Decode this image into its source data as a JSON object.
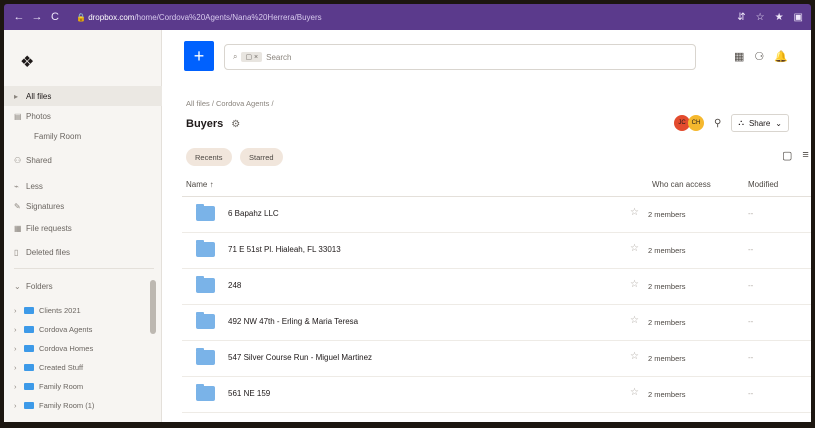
{
  "browser": {
    "nav": [
      "←",
      "→",
      "C"
    ],
    "url_host": "dropbox.com",
    "url_path": "/home/Cordova%20Agents/Nana%20Herrera/Buyers",
    "right_icons": [
      "⇵",
      "☆",
      "★",
      "▣"
    ]
  },
  "sidebar": {
    "logo": "❖",
    "items": [
      {
        "icon": "▸",
        "label": "All files"
      },
      {
        "icon": "▤",
        "label": "Photos"
      },
      {
        "icon": "",
        "label": "Family Room"
      },
      {
        "icon": "⚇",
        "label": "Shared"
      },
      {
        "icon": "⌁",
        "label": "Less"
      },
      {
        "icon": "✎",
        "label": "Signatures"
      },
      {
        "icon": "▦",
        "label": "File requests"
      },
      {
        "icon": "▯",
        "label": "Deleted files"
      }
    ],
    "folders_label": "Folders",
    "folders_chevron": "⌄",
    "folders": [
      {
        "label": "Clients 2021"
      },
      {
        "label": "Cordova Agents"
      },
      {
        "label": "Cordova Homes"
      },
      {
        "label": "Created Stuff"
      },
      {
        "label": "Family Room"
      },
      {
        "label": "Family Room (1)"
      }
    ]
  },
  "topbar": {
    "plus": "+",
    "search_icon": "⌕",
    "search_chip": "▢ ×",
    "search_placeholder": "Search",
    "icons": [
      "▦",
      "⚆",
      "🔔"
    ]
  },
  "breadcrumb": "All files / Cordova Agents /",
  "page_title": "Buyers",
  "settings_icon": "⚙",
  "share": {
    "avatar1": "JC",
    "avatar2": "CH",
    "link_icon": "⚲",
    "share_icon": "⛬",
    "share_label": "Share",
    "share_chevron": "⌄"
  },
  "filters": [
    "Recents",
    "Starred"
  ],
  "view_icons": [
    "▢",
    "≡"
  ],
  "columns": {
    "name": "Name ↑",
    "access": "Who can access",
    "modified": "Modified"
  },
  "rows": [
    {
      "name": "6 Bapahz LLC",
      "access": "2 members",
      "modified": "--"
    },
    {
      "name": "71 E 51st Pl. Hialeah, FL 33013",
      "access": "2 members",
      "modified": "--"
    },
    {
      "name": "248",
      "access": "2 members",
      "modified": "--"
    },
    {
      "name": "492 NW 47th - Erling & Maria Teresa",
      "access": "2 members",
      "modified": "--"
    },
    {
      "name": "547 Silver Course Run - Miguel Martinez",
      "access": "2 members",
      "modified": "--"
    },
    {
      "name": "561 NE 159",
      "access": "2 members",
      "modified": "--"
    }
  ],
  "colors": {
    "brand": "#0061fe",
    "chrome": "#5b3a8c",
    "folder": "#7ab3e8"
  }
}
